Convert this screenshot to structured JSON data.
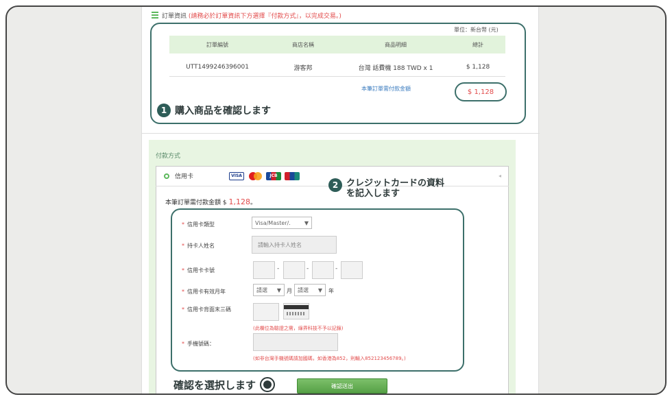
{
  "order": {
    "title": "訂單資訊",
    "note": "(請務必於訂單資訊下方選擇『付款方式』，以完成交易。)",
    "unit": "單位：新台幣 (元)",
    "columns": [
      "訂單編號",
      "商店名稱",
      "商品明細",
      "總計"
    ],
    "row": {
      "id": "UTT1499246396001",
      "store": "游客邦",
      "item": "台灣 話費機 188 TWD x 1",
      "total": "$ 1,128"
    },
    "total_label": "本筆訂單需付款金額",
    "total_amount": "$ 1,128"
  },
  "steps": {
    "step1_number": "1",
    "step1_text": "購入商品を確認します",
    "step2_number": "2",
    "step2_line1": "クレジットカードの資料",
    "step2_line2": "を記入します",
    "confirm_text": "確認を選択します"
  },
  "payment": {
    "section_title": "付款方式",
    "method_label": "信用卡",
    "card_logos": [
      "VISA",
      "MasterCard",
      "JCB",
      "UnionPay"
    ],
    "collapse_glyph": "◂",
    "amount_label": "本筆訂單需付款金額 $",
    "amount_value": "1,128",
    "amount_suffix": "。"
  },
  "form": {
    "required_mark": "*",
    "card_type_label": "信用卡類型",
    "card_type_value": "Visa/Master/.",
    "holder_label": "持卡人姓名",
    "holder_placeholder": "請輸入持卡人姓名",
    "card_number_label": "信用卡卡號",
    "expiry_label": "信用卡有效月年",
    "month_select": "請選",
    "month_unit": "月",
    "year_select": "請選",
    "year_unit": "年",
    "cvv_label": "信用卡背面末三碼",
    "cvv_note": "(此欄位為驗證之需，綠界科技不予以記錄)",
    "phone_label": "手機號碼：",
    "phone_note": "(如非台灣手機號碼請加國碼，如香港為852，則輸入852123456789。)",
    "dash": "-",
    "arrow": "▼"
  },
  "submit_label": "確認送出"
}
